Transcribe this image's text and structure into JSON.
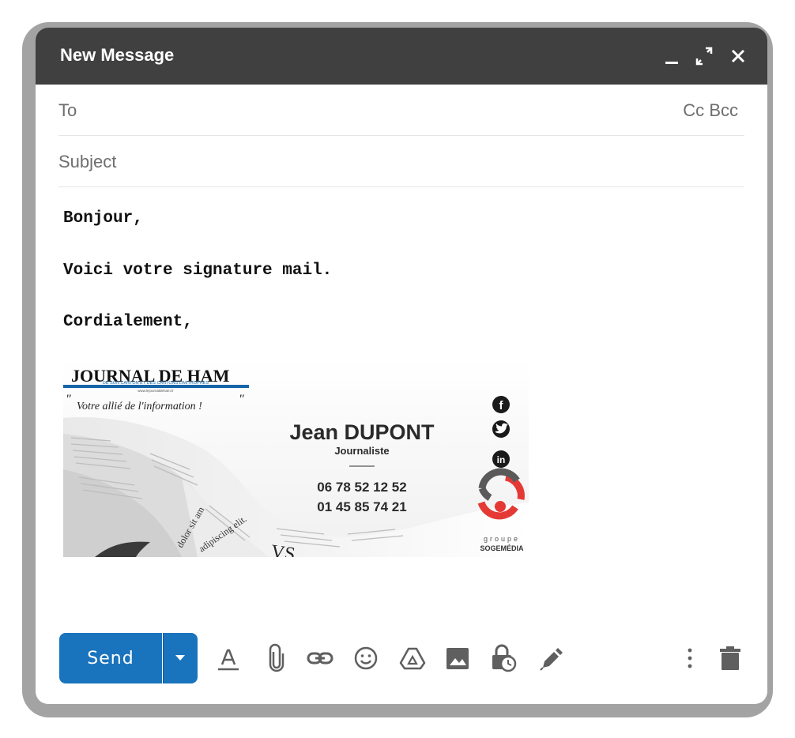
{
  "compose": {
    "title": "New Message",
    "to_label": "To",
    "cc_label": "Cc",
    "bcc_label": "Bcc",
    "subject_placeholder": "Subject",
    "body_lines": [
      "Bonjour,",
      "Voici votre signature mail.",
      "Cordialement,"
    ]
  },
  "signature": {
    "journal_name": "JOURNAL DE HAM",
    "journal_sub": "DE SON CANTON ET DES CANTONS LIMITROPHES",
    "journal_url": "www.lejournaldeham.fr",
    "tagline": "Votre allié de l'information !",
    "quote_open": "\"",
    "quote_close": "\"",
    "name": "Jean DUPONT",
    "role": "Journaliste",
    "phone1": "06 78 52 12 52",
    "phone2": "01 45 85 74 21",
    "group_word": "groupe",
    "group_name": "SOGEMÉDIA",
    "newspaper_text1": "dolor sit am",
    "newspaper_text2": "adipiscing elit.",
    "newspaper_text3": "VS"
  },
  "toolbar": {
    "send_label": "Send"
  },
  "colors": {
    "header_bg": "#404040",
    "send_bg": "#1a73bd",
    "brand_blue": "#1565a8",
    "brand_red": "#e53935"
  }
}
